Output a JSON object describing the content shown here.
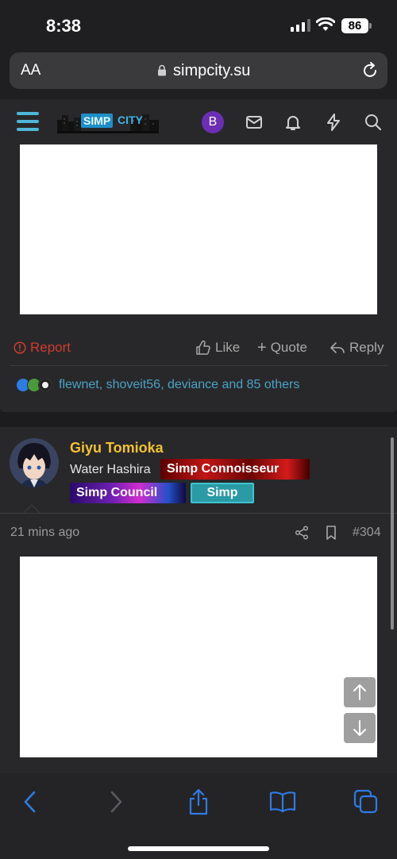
{
  "status": {
    "time": "8:38",
    "battery": "86"
  },
  "browser": {
    "text_size_label": "AA",
    "domain": "simpcity.su"
  },
  "site": {
    "logo_text_1": "SIMP",
    "logo_text_2": "CITY",
    "user_initial": "B",
    "accent_color": "#4db6d9"
  },
  "post1": {
    "report_label": "Report",
    "like_label": "Like",
    "quote_label": "Quote",
    "reply_label": "Reply",
    "reactions_text": "flewnet, shoveit56, deviance and 85 others"
  },
  "post2": {
    "username": "Giyu Tomioka",
    "user_title": "Water Hashira",
    "badges": [
      "Simp Connoisseur",
      "Simp Council",
      "Simp"
    ],
    "time_ago": "21 mins ago",
    "post_number": "#304"
  },
  "colors": {
    "username": "#f2c230",
    "report": "#d23a2f",
    "link": "#4aa3c6",
    "toolbar_icon": "#2f7be6"
  }
}
